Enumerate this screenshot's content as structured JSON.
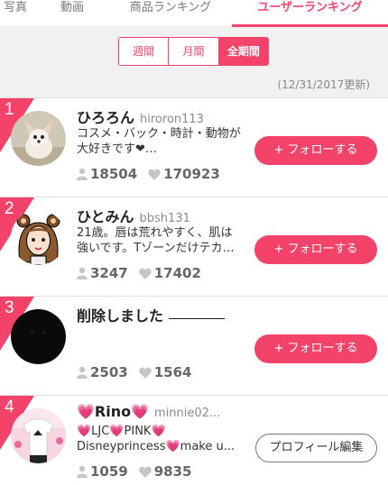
{
  "tabs": {
    "photo": "写真",
    "video": "動画",
    "products": "商品ランキング",
    "users": "ユーザーランキング"
  },
  "period": {
    "week": "週間",
    "month": "月間",
    "all": "全期間",
    "selected": "全期間"
  },
  "updated_label": "(12/31/2017更新)",
  "colors": {
    "accent": "#f4436a"
  },
  "users": [
    {
      "rank": "1",
      "name": "ひろろん",
      "id": "hiroron113",
      "bio": "コスメ・バック・時計・動物が\n大好きです❤…",
      "followers": "18504",
      "likes": "170923",
      "button": "+ フォローする",
      "avatar": "dog-photo"
    },
    {
      "rank": "2",
      "name": "ひとみん",
      "id": "bbsh131",
      "bio": "21歳。唇は荒れやすく、肌は\n強いです。Tゾーンだけテカ…",
      "followers": "3247",
      "likes": "17402",
      "button": "+ フォローする",
      "avatar": "girl-illustration"
    },
    {
      "rank": "3",
      "name": "削除しました",
      "id": "",
      "bio": "",
      "followers": "2503",
      "likes": "1564",
      "button": "+ フォローする",
      "avatar": "black-circle"
    },
    {
      "rank": "4",
      "name": "💗Rino💗",
      "id": "minnie02...",
      "bio": "💗LJC💗PINK💗\nDisneyprincess💗make u...",
      "followers": "1059",
      "likes": "9835",
      "button": "プロフィール編集",
      "avatar": "tshirt-photo"
    }
  ]
}
